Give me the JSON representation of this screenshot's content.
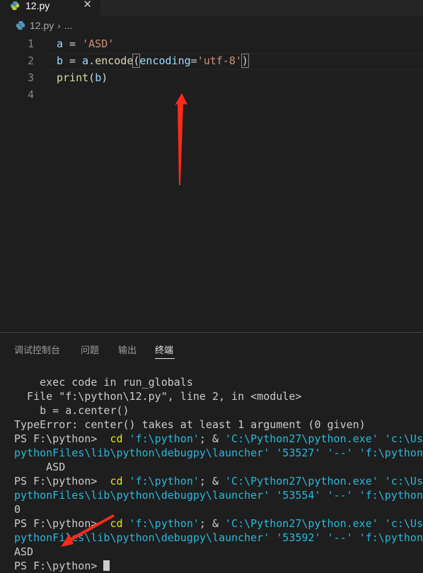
{
  "editor_tab": {
    "label": "12.py",
    "close": "✕",
    "icon": "python-file-icon"
  },
  "breadcrumb": {
    "file": "12.py",
    "separator": "›",
    "more": "..."
  },
  "code": {
    "line_numbers": [
      "1",
      "2",
      "3",
      "4"
    ],
    "line1": {
      "var": "a",
      "eq": " = ",
      "str": "'ASD'"
    },
    "line2": {
      "var": "b",
      "eq": " = ",
      "obj": "a",
      "dot": ".",
      "method": "encode",
      "open": "(",
      "kw": "encoding",
      "kweq": "=",
      "str": "'utf-8'",
      "close": ")"
    },
    "line3": {
      "fn": "print",
      "open": "(",
      "arg": "b",
      "close": ")"
    }
  },
  "panel": {
    "tabs": [
      "调试控制台",
      "问题",
      "输出",
      "终端"
    ],
    "active_tab": "终端"
  },
  "terminal": {
    "l1": "    exec code in run_globals",
    "l2": "  File \"f:\\python\\12.py\", line 2, in <module>",
    "l3": "    b = a.center()",
    "l4": "TypeError: center() takes at least 1 argument (0 given)",
    "prompt": "PS F:\\python> ",
    "cd": " cd",
    "path1": " 'f:\\python'",
    "amp": "; & ",
    "exe": "'C:\\Python27\\python.exe'",
    "ext": " 'c:\\Use",
    "run1": "pythonFiles\\lib\\python\\debugpy\\launcher' '53527' '--' 'f:\\python",
    "out1": "     ASD",
    "run2": "pythonFiles\\lib\\python\\debugpy\\launcher' '53554' '--' 'f:\\python",
    "out2": "0",
    "run3": "pythonFiles\\lib\\python\\debugpy\\launcher' '53592' '--' 'f:\\python",
    "out3": "ASD",
    "final_prompt": "PS F:\\python> "
  },
  "colors": {
    "background": "#1e1e1e",
    "annotation_arrow": "#ff2a1a",
    "string": "#ce9178",
    "variable": "#9cdcfe",
    "function": "#dcdcaa",
    "terminal_yellow": "#e5e510",
    "terminal_cyan": "#29b8db"
  }
}
